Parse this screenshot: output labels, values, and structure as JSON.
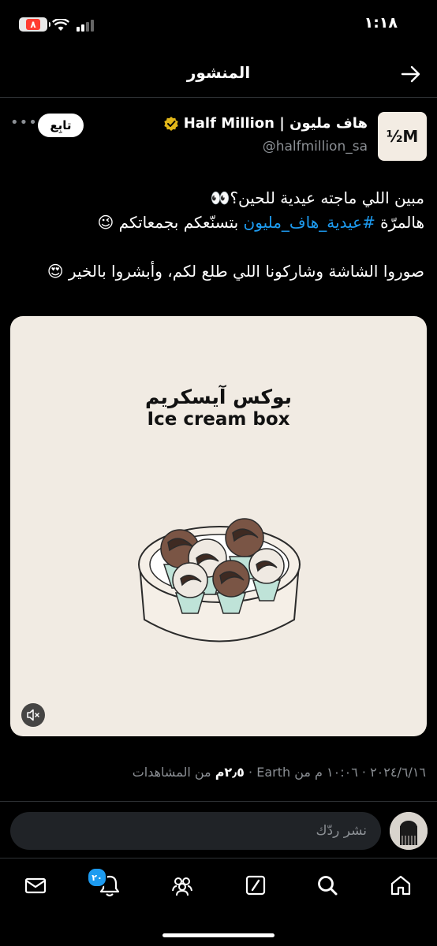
{
  "status_bar": {
    "time": "١:١٨",
    "battery": "٨"
  },
  "header": {
    "title": "المنشور"
  },
  "post": {
    "display_name": "هاف مليون | Half Million",
    "handle": "@halfmillion_sa",
    "avatar_text": "½M",
    "follow_label": "تابِع",
    "text": {
      "line1": "مبين اللي ماجته عيدية للحين؟👀",
      "line2_prefix": "هالمرّة ",
      "hashtag": "#عيدية_هاف_مليون",
      "line2_suffix": " بتسنّعكم بجمعاتكم 😉",
      "line3": "صوروا الشاشة وشاركونا اللي طلع لكم، وأبشروا بالخير 😍"
    },
    "media": {
      "title_ar": "بوكس آيسكريم",
      "title_en": "Ice cream box"
    },
    "meta": {
      "date_time": "٢٠٢٤/٦/١٦ · ١٠:٠٦ م من Earth · ",
      "views_count": "٢٫٥م",
      "views_label": " من المشاهدات"
    }
  },
  "reply": {
    "placeholder": "نشر ردّك"
  },
  "nav": {
    "notifications_badge": "٢٠"
  }
}
